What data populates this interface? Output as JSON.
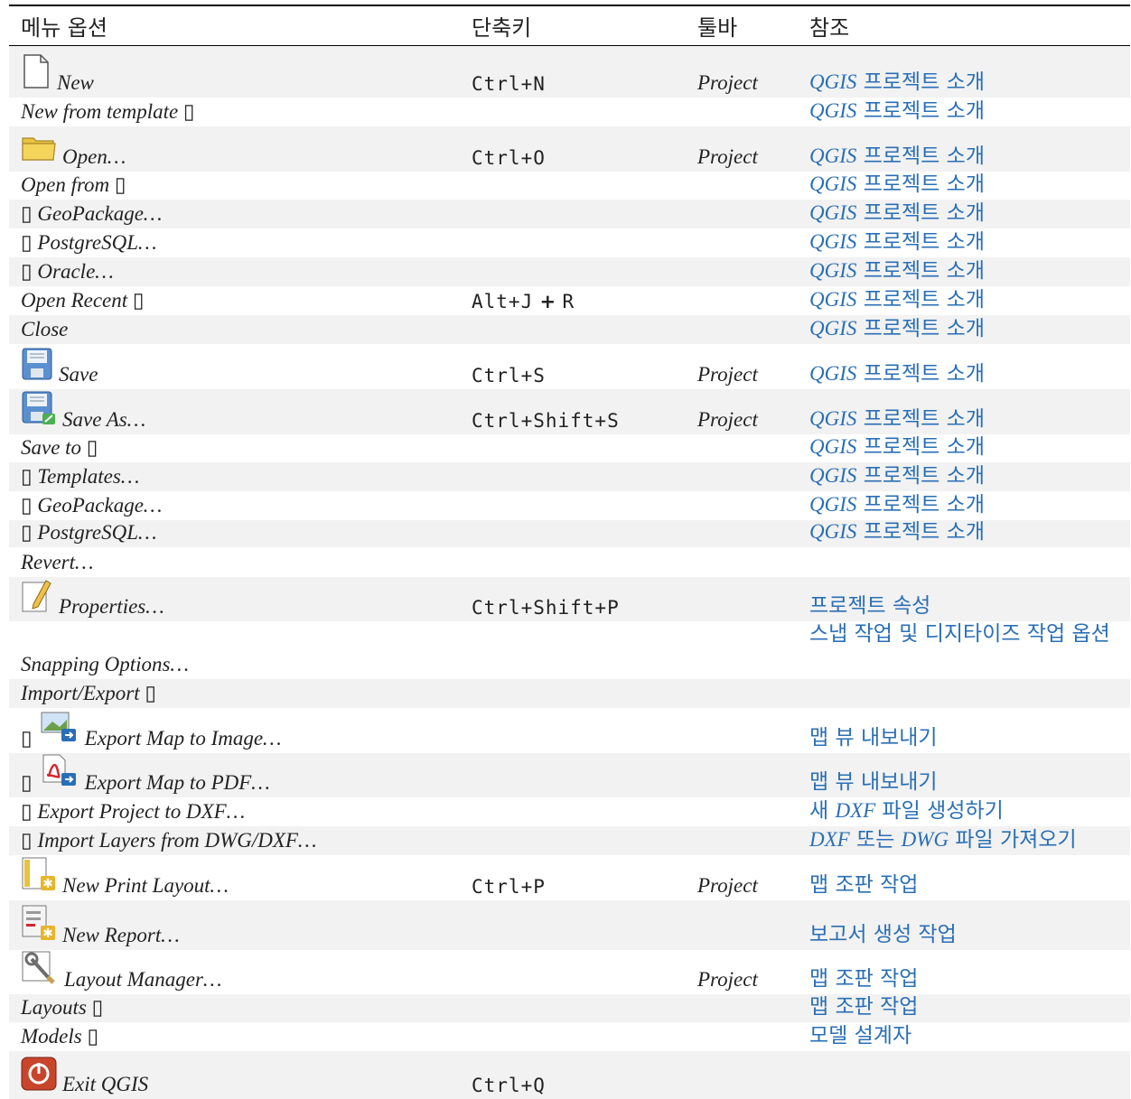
{
  "headers": {
    "menu": "메뉴 옵션",
    "shortcut": "단축키",
    "toolbar": "툴바",
    "reference": "참조"
  },
  "rows": [
    {
      "menu": "New",
      "icon": "new-file-icon",
      "shortcut": "Ctrl+N",
      "toolbar": "Project",
      "ref_pre": "QGIS",
      "ref": " 프로젝트 소개"
    },
    {
      "menu": "New from template ▯",
      "icon": "",
      "shortcut": "",
      "toolbar": "",
      "ref_pre": "QGIS",
      "ref": " 프로젝트 소개"
    },
    {
      "menu": "Open…",
      "icon": "folder-icon",
      "shortcut": "Ctrl+O",
      "toolbar": "Project",
      "ref_pre": "QGIS",
      "ref": " 프로젝트 소개"
    },
    {
      "menu": "Open from ▯",
      "icon": "",
      "shortcut": "",
      "toolbar": "",
      "ref_pre": "QGIS",
      "ref": " 프로젝트 소개"
    },
    {
      "menu": "▯ GeoPackage…",
      "icon": "",
      "shortcut": "",
      "toolbar": "",
      "ref_pre": "QGIS",
      "ref": " 프로젝트 소개"
    },
    {
      "menu": "▯ PostgreSQL…",
      "icon": "",
      "shortcut": "",
      "toolbar": "",
      "ref_pre": "QGIS",
      "ref": " 프로젝트 소개"
    },
    {
      "menu": "▯ Oracle…",
      "icon": "",
      "shortcut": "",
      "toolbar": "",
      "ref_pre": "QGIS",
      "ref": " 프로젝트 소개"
    },
    {
      "menu": "Open Recent ▯",
      "icon": "",
      "shortcut_a": "Alt+J",
      "shortcut_plus": "+",
      "shortcut_b": "R",
      "toolbar": "",
      "ref_pre": "QGIS",
      "ref": " 프로젝트 소개"
    },
    {
      "menu": "Close",
      "icon": "",
      "shortcut": "",
      "toolbar": "",
      "ref_pre": "QGIS",
      "ref": " 프로젝트 소개"
    },
    {
      "menu": "Save",
      "icon": "save-icon",
      "shortcut": "Ctrl+S",
      "toolbar": "Project",
      "ref_pre": "QGIS",
      "ref": " 프로젝트 소개"
    },
    {
      "menu": "Save As…",
      "icon": "save-as-icon",
      "shortcut": "Ctrl+Shift+S",
      "toolbar": "Project",
      "ref_pre": "QGIS",
      "ref": " 프로젝트 소개"
    },
    {
      "menu": "Save to ▯",
      "icon": "",
      "shortcut": "",
      "toolbar": "",
      "ref_pre": "QGIS",
      "ref": " 프로젝트 소개"
    },
    {
      "menu": "▯ Templates…",
      "icon": "",
      "shortcut": "",
      "toolbar": "",
      "ref_pre": "QGIS",
      "ref": " 프로젝트 소개"
    },
    {
      "menu": "▯ GeoPackage…",
      "icon": "",
      "shortcut": "",
      "toolbar": "",
      "ref_pre": "QGIS",
      "ref": " 프로젝트 소개"
    },
    {
      "menu": "▯ PostgreSQL…",
      "icon": "",
      "shortcut": "",
      "toolbar": "",
      "ref_pre": "QGIS",
      "ref": " 프로젝트 소개"
    },
    {
      "menu": "Revert…",
      "icon": "",
      "shortcut": "",
      "toolbar": "",
      "ref_pre": "",
      "ref": ""
    },
    {
      "menu": "Properties…",
      "icon": "pencil-icon",
      "shortcut": "Ctrl+Shift+P",
      "toolbar": "",
      "ref_pre": "",
      "ref": "프로젝트 속성"
    },
    {
      "menu": "Snapping Options…",
      "icon": "",
      "shortcut": "",
      "toolbar": "",
      "ref_pre": "",
      "ref": "스냅 작업 및 디지타이즈 작업 옵션"
    },
    {
      "menu": "Import/Export ▯",
      "icon": "",
      "shortcut": "",
      "toolbar": "",
      "ref_pre": "",
      "ref": ""
    },
    {
      "menu_pre": "▯",
      "menu": "Export Map to Image…",
      "icon": "export-image-icon",
      "shortcut": "",
      "toolbar": "",
      "ref_pre": "",
      "ref": "맵 뷰 내보내기"
    },
    {
      "menu_pre": "▯",
      "menu": "Export Map to PDF…",
      "icon": "export-pdf-icon",
      "shortcut": "",
      "toolbar": "",
      "ref_pre": "",
      "ref": "맵 뷰 내보내기"
    },
    {
      "menu": "▯ Export Project to DXF…",
      "icon": "",
      "shortcut": "",
      "toolbar": "",
      "ref_a": "새 ",
      "ref_i": "DXF",
      "ref_b": " 파일 생성하기"
    },
    {
      "menu": "▯ Import Layers from DWG/DXF…",
      "icon": "",
      "shortcut": "",
      "toolbar": "",
      "ref_i1": "DXF",
      "ref_m": " 또는 ",
      "ref_i2": "DWG",
      "ref_e": " 파일 가져오기"
    },
    {
      "menu": "New Print Layout…",
      "icon": "new-print-layout-icon",
      "shortcut": "Ctrl+P",
      "toolbar": "Project",
      "ref_pre": "",
      "ref": "맵 조판 작업"
    },
    {
      "menu": "New Report…",
      "icon": "new-report-icon",
      "shortcut": "",
      "toolbar": "",
      "ref_pre": "",
      "ref": "보고서 생성 작업"
    },
    {
      "menu": "Layout Manager…",
      "icon": "layout-manager-icon",
      "shortcut": "",
      "toolbar": "Project",
      "ref_pre": "",
      "ref": "맵 조판 작업"
    },
    {
      "menu": "Layouts ▯",
      "icon": "",
      "shortcut": "",
      "toolbar": "",
      "ref_pre": "",
      "ref": "맵 조판 작업"
    },
    {
      "menu": "Models ▯",
      "icon": "",
      "shortcut": "",
      "toolbar": "",
      "ref_pre": "",
      "ref": "모델 설계자"
    },
    {
      "menu": "Exit QGIS",
      "icon": "exit-icon",
      "shortcut": "Ctrl+Q",
      "toolbar": "",
      "ref_pre": "",
      "ref": ""
    }
  ]
}
